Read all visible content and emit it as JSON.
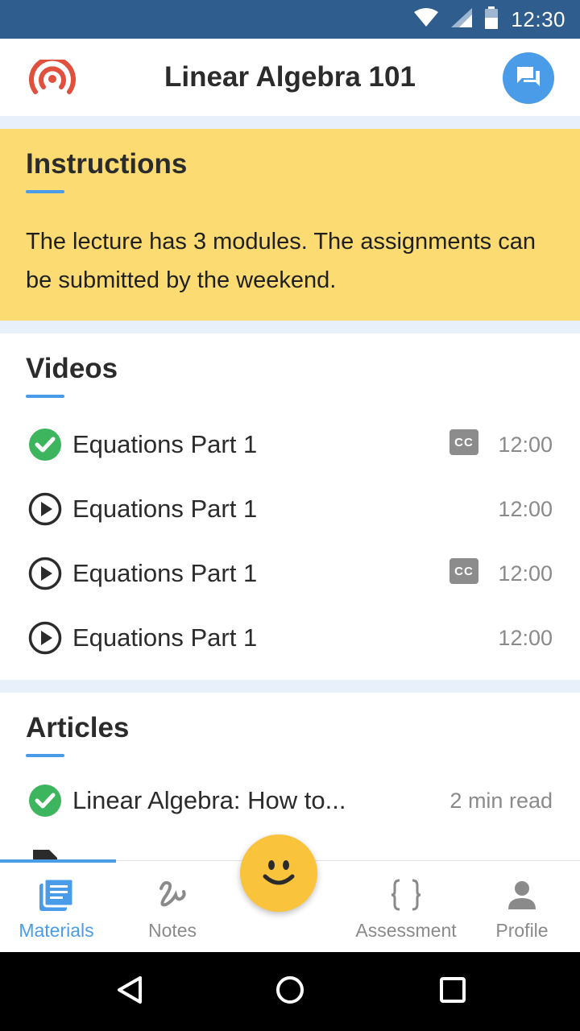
{
  "status_bar": {
    "time": "12:30"
  },
  "app_bar": {
    "title": "Linear Algebra 101",
    "logo_icon": "broadcast-icon",
    "chat_icon": "chat-icon"
  },
  "instructions": {
    "title": "Instructions",
    "text": "The lecture has 3 modules. The assignments can be submitted by the weekend."
  },
  "videos": {
    "title": "Videos",
    "items": [
      {
        "title": "Equations Part 1",
        "duration": "12:00",
        "status": "completed",
        "has_cc": true,
        "cc_label": "CC"
      },
      {
        "title": "Equations Part 1",
        "duration": "12:00",
        "status": "play",
        "has_cc": false
      },
      {
        "title": "Equations Part 1",
        "duration": "12:00",
        "status": "play",
        "has_cc": true,
        "cc_label": "CC"
      },
      {
        "title": "Equations Part 1",
        "duration": "12:00",
        "status": "play",
        "has_cc": false
      }
    ]
  },
  "articles": {
    "title": "Articles",
    "items": [
      {
        "title": "Linear Algebra: How to...",
        "meta": "2 min read",
        "status": "completed"
      }
    ]
  },
  "bottom_nav": {
    "items": [
      {
        "label": "Materials",
        "icon": "materials-icon",
        "active": true
      },
      {
        "label": "Notes",
        "icon": "notes-icon",
        "active": false
      },
      {
        "label": "Assessment",
        "icon": "braces-icon",
        "active": false
      },
      {
        "label": "Profile",
        "icon": "profile-icon",
        "active": false
      }
    ],
    "fab_icon": "smiley-icon"
  },
  "colors": {
    "accent": "#4a9ce8",
    "status_bar": "#2f5d8e",
    "instructions_bg": "#fcdc72",
    "completed_green": "#3cb55e",
    "fab": "#f9c33c",
    "logo_red": "#e0503d"
  }
}
